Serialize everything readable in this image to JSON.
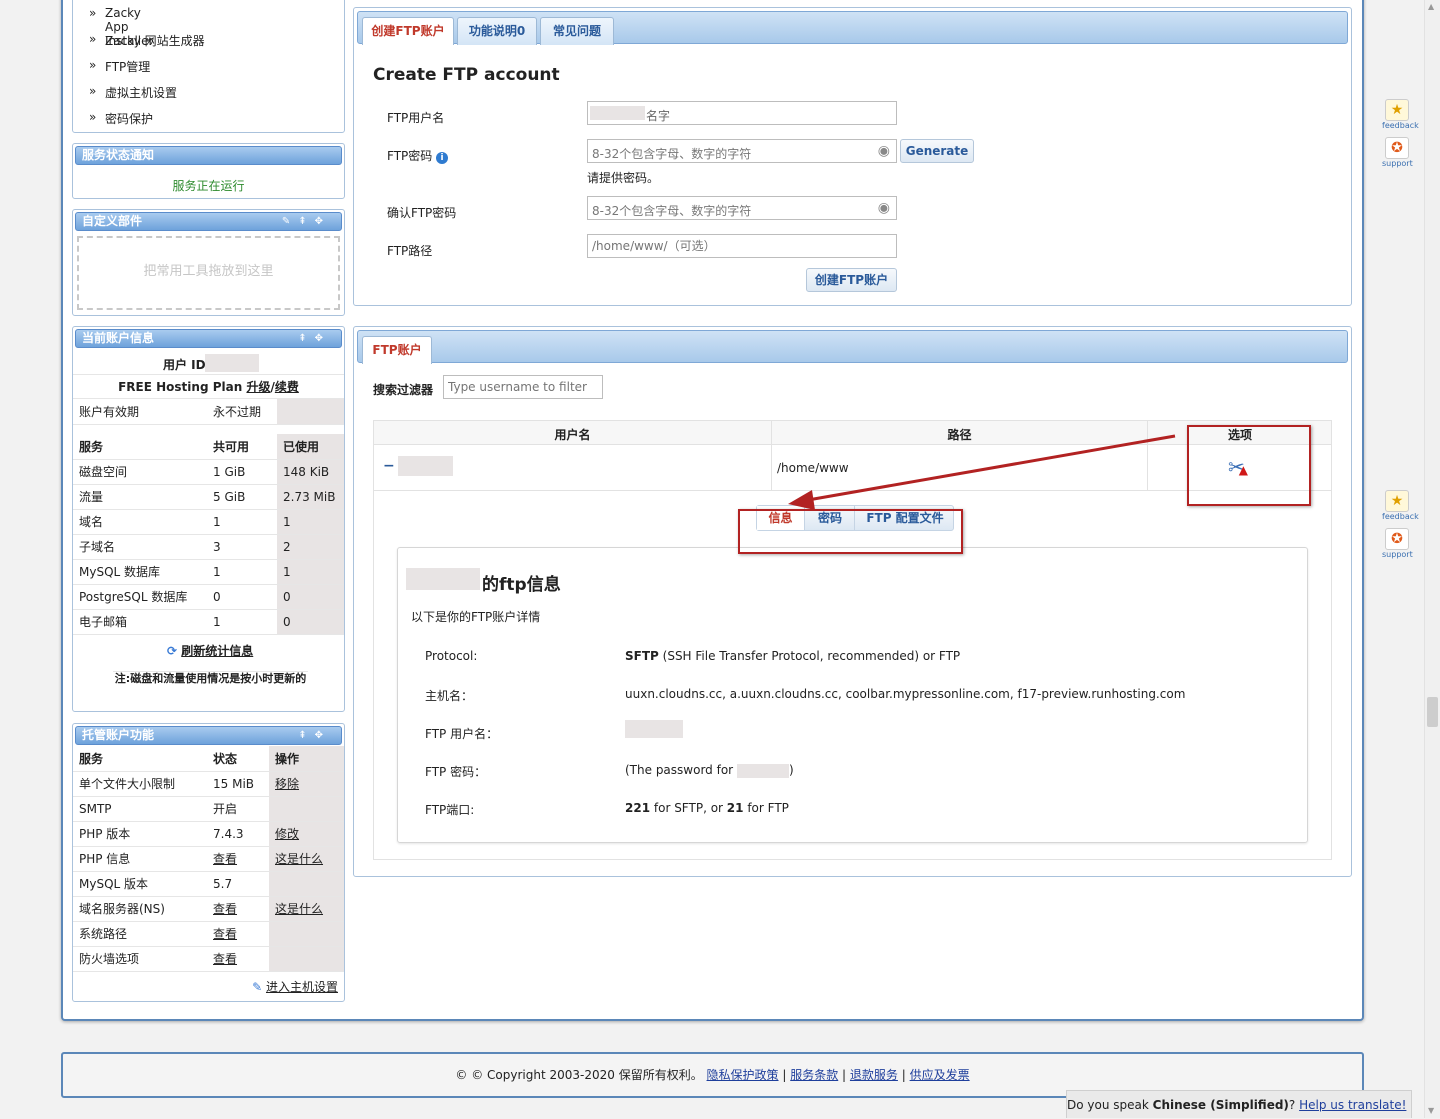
{
  "sidebar": {
    "menu": [
      "Zacky App Installer",
      "Zacky 网站生成器",
      "FTP管理",
      "虚拟主机设置",
      "密码保护"
    ],
    "bullet": "»",
    "status_title": "服务状态通知",
    "status_text": "服务正在运行",
    "widgets_title": "自定义部件",
    "widgets_drop": "把常用工具拖放到这里",
    "account_title": "当前账户信息",
    "user_id_label": "用户 ID",
    "plan_text": "FREE Hosting Plan",
    "plan_upgrade": "升级",
    "plan_sep": "/",
    "plan_renew": "续费",
    "validity_label": "账户有效期",
    "validity_value": "永不过期",
    "usage_headers": [
      "服务",
      "共可用",
      "已使用"
    ],
    "usage_rows": [
      [
        "磁盘空间",
        "1 GiB",
        "148 KiB"
      ],
      [
        "流量",
        "5 GiB",
        "2.73 MiB"
      ],
      [
        "域名",
        "1",
        "1"
      ],
      [
        "子域名",
        "3",
        "2"
      ],
      [
        "MySQL 数据库",
        "1",
        "1"
      ],
      [
        "PostgreSQL 数据库",
        "0",
        "0"
      ],
      [
        "电子邮箱",
        "1",
        "0"
      ]
    ],
    "refresh_label": "刷新统计信息",
    "note_text": "注:磁盘和流量使用情况是按小时更新的",
    "features_title": "托管账户功能",
    "feature_headers": [
      "服务",
      "状态",
      "操作"
    ],
    "feature_rows": [
      [
        "单个文件大小限制",
        "15 MiB",
        "移除"
      ],
      [
        "SMTP",
        "开启",
        ""
      ],
      [
        "PHP 版本",
        "7.4.3",
        "修改"
      ],
      [
        "PHP 信息",
        "查看",
        "这是什么"
      ],
      [
        "MySQL 版本",
        "5.7",
        ""
      ],
      [
        "域名服务器(NS)",
        "查看",
        "这是什么"
      ],
      [
        "系统路径",
        "查看",
        ""
      ],
      [
        "防火墙选项",
        "查看",
        ""
      ]
    ],
    "host_settings_link": "进入主机设置"
  },
  "create": {
    "tabs": [
      "创建FTP账户",
      "功能说明0",
      "常见问题"
    ],
    "heading": "Create FTP account",
    "username_label": "FTP用户名",
    "username_suffix": "名字",
    "password_label": "FTP密码",
    "password_placeholder": "8-32个包含字母、数字的字符",
    "generate_label": "Generate",
    "password_hint": "请提供密码。",
    "confirm_label": "确认FTP密码",
    "confirm_placeholder": "8-32个包含字母、数字的字符",
    "path_label": "FTP路径",
    "path_placeholder": "/home/www/（可选）",
    "submit_label": "创建FTP账户"
  },
  "accounts": {
    "tab": "FTP账户",
    "filter_label": "搜索过滤器",
    "filter_placeholder": "Type username to filter",
    "col_user": "用户名",
    "col_path": "路径",
    "col_options": "选项",
    "row_toggle": "−",
    "row_path": "/home/www",
    "detail_tabs": [
      "信息",
      "密码",
      "FTP 配置文件"
    ],
    "detail_title_suffix": "的ftp信息",
    "detail_intro": "以下是你的FTP账户详情",
    "protocol_label": "Protocol:",
    "protocol_bold": "SFTP",
    "protocol_rest": " (SSH File Transfer Protocol, recommended) or FTP",
    "host_label": "主机名：",
    "host_value": "uuxn.cloudns.cc, a.uuxn.cloudns.cc, coolbar.mypressonline.com, f17-preview.runhosting.com",
    "user_label": "FTP 用户名：",
    "pass_label": "FTP 密码：",
    "pass_value_pre": "(The password for",
    "pass_value_post": ")",
    "port_label": "FTP端口:",
    "port_sftp": "221",
    "port_sftp_rest": " for SFTP, or ",
    "port_ftp": "21",
    "port_ftp_rest": " for FTP"
  },
  "footer": {
    "copyright": "© © Copyright  2003-2020 保留所有权利。",
    "links": [
      "隐私保护政策",
      "服务条款",
      "退款服务",
      "供应及发票"
    ]
  },
  "translate": {
    "prefix": "Do you speak ",
    "lang": "Chinese (Simplified)",
    "q": "?",
    "link": "Help us translate!"
  },
  "side_icons": [
    "feedback",
    "support",
    "feedback",
    "support"
  ],
  "colors": {
    "accent": "#5b87b8",
    "tab_active": "#c0392b",
    "status_ok": "#2e8b2e",
    "annotation": "#b22222"
  }
}
